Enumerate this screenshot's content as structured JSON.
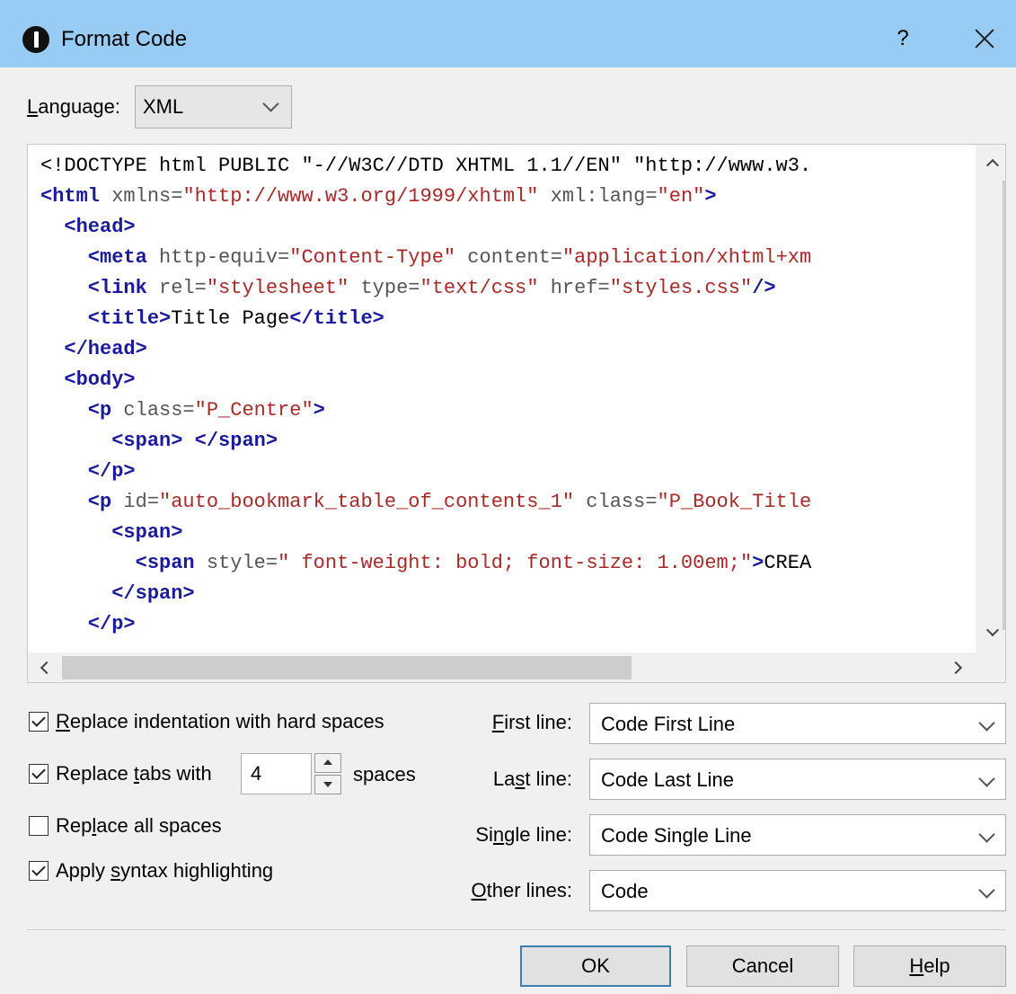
{
  "title": "Format Code",
  "help_glyph": "?",
  "language": {
    "label": "Language:",
    "value": "XML"
  },
  "code_lines": [
    [
      {
        "c": "tx",
        "t": "<!DOCTYPE html PUBLIC \"-//W3C//DTD XHTML 1.1//EN\" \"http://www.w3."
      }
    ],
    [
      {
        "c": "tg",
        "t": "<html"
      },
      {
        "c": "at",
        "t": " xmlns="
      },
      {
        "c": "av",
        "t": "\"http://www.w3.org/1999/xhtml\""
      },
      {
        "c": "at",
        "t": " xml:lang="
      },
      {
        "c": "av",
        "t": "\"en\""
      },
      {
        "c": "tg",
        "t": ">"
      }
    ],
    [
      {
        "c": "tg",
        "t": "  <head>"
      }
    ],
    [
      {
        "c": "tg",
        "t": "    <meta"
      },
      {
        "c": "at",
        "t": " http-equiv="
      },
      {
        "c": "av",
        "t": "\"Content-Type\""
      },
      {
        "c": "at",
        "t": " content="
      },
      {
        "c": "av",
        "t": "\"application/xhtml+xm"
      }
    ],
    [
      {
        "c": "tg",
        "t": "    <link"
      },
      {
        "c": "at",
        "t": " rel="
      },
      {
        "c": "av",
        "t": "\"stylesheet\""
      },
      {
        "c": "at",
        "t": " type="
      },
      {
        "c": "av",
        "t": "\"text/css\""
      },
      {
        "c": "at",
        "t": " href="
      },
      {
        "c": "av",
        "t": "\"styles.css\""
      },
      {
        "c": "tg",
        "t": "/>"
      }
    ],
    [
      {
        "c": "tg",
        "t": "    <title>"
      },
      {
        "c": "tx",
        "t": "Title Page"
      },
      {
        "c": "tg",
        "t": "</title>"
      }
    ],
    [
      {
        "c": "tg",
        "t": "  </head>"
      }
    ],
    [
      {
        "c": "tg",
        "t": "  <body>"
      }
    ],
    [
      {
        "c": "tg",
        "t": "    <p"
      },
      {
        "c": "at",
        "t": " class="
      },
      {
        "c": "av",
        "t": "\"P_Centre\""
      },
      {
        "c": "tg",
        "t": ">"
      }
    ],
    [
      {
        "c": "tg",
        "t": "      <span>"
      },
      {
        "c": "tx",
        "t": " "
      },
      {
        "c": "tg",
        "t": "</span>"
      }
    ],
    [
      {
        "c": "tg",
        "t": "    </p>"
      }
    ],
    [
      {
        "c": "tg",
        "t": "    <p"
      },
      {
        "c": "at",
        "t": " id="
      },
      {
        "c": "av",
        "t": "\"auto_bookmark_table_of_contents_1\""
      },
      {
        "c": "at",
        "t": " class="
      },
      {
        "c": "av",
        "t": "\"P_Book_Title"
      }
    ],
    [
      {
        "c": "tg",
        "t": "      <span>"
      }
    ],
    [
      {
        "c": "tg",
        "t": "        <span"
      },
      {
        "c": "at",
        "t": " style="
      },
      {
        "c": "av",
        "t": "\" font-weight: bold; font-size: 1.00em;\""
      },
      {
        "c": "tg",
        "t": ">"
      },
      {
        "c": "tx",
        "t": "CREA"
      }
    ],
    [
      {
        "c": "tg",
        "t": "      </span>"
      }
    ],
    [
      {
        "c": "tg",
        "t": "    </p>"
      }
    ]
  ],
  "options": {
    "replace_indentation": {
      "label_pre": "",
      "label_key": "R",
      "label_post": "eplace indentation with hard spaces",
      "checked": true
    },
    "replace_tabs": {
      "label_pre": "Replace ",
      "label_key": "t",
      "label_post": "abs with",
      "checked": true,
      "value": "4",
      "suffix": "spaces"
    },
    "replace_all_spaces": {
      "label_pre": "Rep",
      "label_key": "l",
      "label_post": "ace all spaces",
      "checked": false
    },
    "syntax_highlighting": {
      "label_pre": "Apply ",
      "label_key": "s",
      "label_post": "yntax highlighting",
      "checked": true
    }
  },
  "styles": {
    "first_line": {
      "label_pre": "",
      "label_key": "F",
      "label_post": "irst line:",
      "value": "Code First Line"
    },
    "last_line": {
      "label_pre": "La",
      "label_key": "s",
      "label_post": "t line:",
      "value": "Code Last Line"
    },
    "single_line": {
      "label_pre": "Si",
      "label_key": "n",
      "label_post": "gle line:",
      "value": "Code Single Line"
    },
    "other_lines": {
      "label_pre": "",
      "label_key": "O",
      "label_post": "ther lines:",
      "value": "Code"
    }
  },
  "buttons": {
    "ok": "OK",
    "cancel": "Cancel",
    "help": {
      "pre": "",
      "key": "H",
      "post": "elp"
    }
  }
}
